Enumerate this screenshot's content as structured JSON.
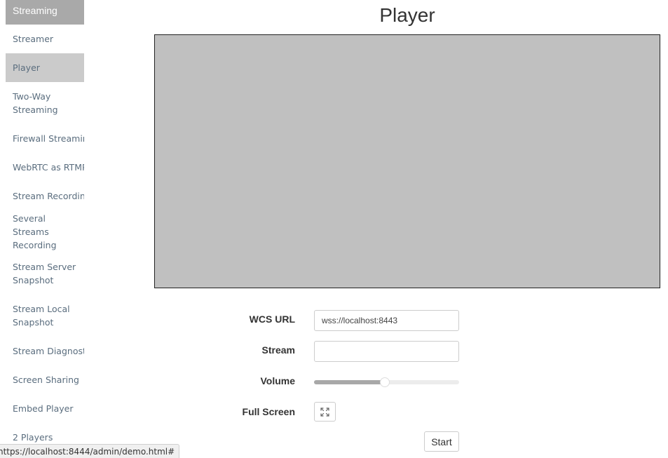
{
  "sidebar": {
    "header": "Streaming",
    "items": [
      {
        "label": "Streamer"
      },
      {
        "label": "Player"
      },
      {
        "label": "Two-Way Streaming"
      },
      {
        "label": "Firewall Streaming"
      },
      {
        "label": "WebRTC as RTMP"
      },
      {
        "label": "Stream Recording"
      },
      {
        "label": "Several Streams Recording"
      },
      {
        "label": "Stream Server Snapshot"
      },
      {
        "label": "Stream Local Snapshot"
      },
      {
        "label": "Stream Diagnostic"
      },
      {
        "label": "Screen Sharing"
      },
      {
        "label": "Embed Player"
      },
      {
        "label": "2 Players"
      }
    ],
    "active_item": "Player"
  },
  "main": {
    "title": "Player",
    "form": {
      "wcs_url_label": "WCS URL",
      "wcs_url_value": "wss://localhost:8443",
      "stream_label": "Stream",
      "stream_value": "",
      "volume_label": "Volume",
      "volume_percent": 49,
      "fullscreen_label": "Full Screen",
      "fullscreen_icon": "expand-icon",
      "start_label": "Start"
    }
  },
  "status_bar": {
    "url": "https://localhost:8444/admin/demo.html#"
  },
  "colors": {
    "sidebar_header_bg": "#a9a9a9",
    "sidebar_active_bg": "#cbcbcb",
    "sidebar_text": "#5a6d7e",
    "video_bg": "#c0c0c0"
  }
}
